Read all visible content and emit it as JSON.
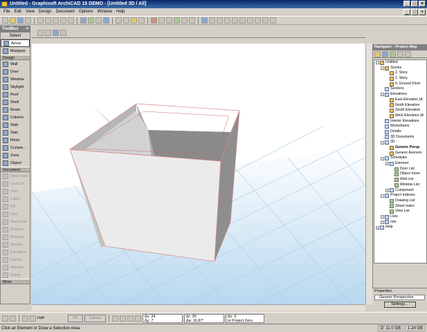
{
  "window": {
    "title": "Untitled - Graphisoft ArchiCAD 15 DEMO - [Untitled 3D / All]"
  },
  "menu": [
    "File",
    "Edit",
    "View",
    "Design",
    "Document",
    "Options",
    "Window",
    "Help"
  ],
  "toolbox": {
    "title": "ToolBox",
    "select_label": "Select",
    "arrow": "Arrow",
    "marquee": "Marquee",
    "design_label": "Design",
    "design_tools": [
      "Wall",
      "Door",
      "Window",
      "Skylight",
      "Roof",
      "Shell",
      "Beam",
      "Column",
      "Slab",
      "Stair",
      "Mesh",
      "Curtain...",
      "Zone",
      "Object"
    ],
    "document_label": "Document",
    "document_tools": [
      "Dimension",
      "Level Di...",
      "Text",
      "Label",
      "Fill",
      "Line",
      "Arc/Circle",
      "Polyline",
      "Drawing",
      "Section",
      "Elevation",
      "Interior...",
      "Worksh...",
      "Detail"
    ],
    "more": "More"
  },
  "navigator": {
    "title": "Navigator - Project Map",
    "tree": [
      {
        "label": "Untitled",
        "level": 0,
        "expand": "-",
        "icon": "y"
      },
      {
        "label": "Stories",
        "level": 1,
        "expand": "-",
        "icon": "y"
      },
      {
        "label": "2. Story",
        "level": 2,
        "expand": "",
        "icon": "y"
      },
      {
        "label": "1. Story",
        "level": 2,
        "expand": "",
        "icon": "y"
      },
      {
        "label": "0. Ground Floor",
        "level": 2,
        "expand": "",
        "icon": "y"
      },
      {
        "label": "Sections",
        "level": 1,
        "expand": "",
        "icon": "s"
      },
      {
        "label": "Elevations",
        "level": 1,
        "expand": "-",
        "icon": "s"
      },
      {
        "label": "East Elevation (A",
        "level": 2,
        "expand": "",
        "icon": "y"
      },
      {
        "label": "North Elevation",
        "level": 2,
        "expand": "",
        "icon": "y"
      },
      {
        "label": "South Elevation",
        "level": 2,
        "expand": "",
        "icon": "y"
      },
      {
        "label": "West Elevation (A",
        "level": 2,
        "expand": "",
        "icon": "y"
      },
      {
        "label": "Interior Elevations",
        "level": 1,
        "expand": "",
        "icon": "s"
      },
      {
        "label": "Worksheets",
        "level": 1,
        "expand": "",
        "icon": "s"
      },
      {
        "label": "Details",
        "level": 1,
        "expand": "",
        "icon": "s"
      },
      {
        "label": "3D Documents",
        "level": 1,
        "expand": "",
        "icon": "s"
      },
      {
        "label": "3D",
        "level": 1,
        "expand": "-",
        "icon": "s"
      },
      {
        "label": "Generic Persp",
        "level": 2,
        "expand": "",
        "icon": "y",
        "selected": true
      },
      {
        "label": "Generic Axonom",
        "level": 2,
        "expand": "",
        "icon": "y"
      },
      {
        "label": "Schedules",
        "level": 1,
        "expand": "-",
        "icon": "s"
      },
      {
        "label": "Element",
        "level": 2,
        "expand": "-",
        "icon": "s"
      },
      {
        "label": "Door List",
        "level": 3,
        "expand": "",
        "icon": "g"
      },
      {
        "label": "Object Inven",
        "level": 3,
        "expand": "",
        "icon": "g"
      },
      {
        "label": "Wall List",
        "level": 3,
        "expand": "",
        "icon": "g"
      },
      {
        "label": "Window List",
        "level": 3,
        "expand": "",
        "icon": "g"
      },
      {
        "label": "Component",
        "level": 2,
        "expand": "+",
        "icon": "s"
      },
      {
        "label": "Project Indexes",
        "level": 1,
        "expand": "-",
        "icon": "s"
      },
      {
        "label": "Drawing List",
        "level": 2,
        "expand": "",
        "icon": "g"
      },
      {
        "label": "Sheet Index",
        "level": 2,
        "expand": "",
        "icon": "g"
      },
      {
        "label": "View List",
        "level": 2,
        "expand": "",
        "icon": "g"
      },
      {
        "label": "Lists",
        "level": 1,
        "expand": "+",
        "icon": "s"
      },
      {
        "label": "Info",
        "level": 1,
        "expand": "+",
        "icon": "s"
      },
      {
        "label": "Help",
        "level": 0,
        "expand": "+",
        "icon": "s"
      }
    ],
    "properties_label": "Properties",
    "properties_value": "Generic Perspective",
    "settings_button": "Settings..."
  },
  "bottom": {
    "zoom_label": "Half",
    "ok": "OK",
    "cancel": "Cancel",
    "dx_label": "Δx:",
    "dx": "24",
    "dy_label": "Δy:",
    "dy": "7",
    "r_label": "Δr:",
    "r": "25",
    "a_label": "Δa:",
    "a": "16,97°",
    "z_label": "Δz:",
    "z": "0",
    "z_ref": "to Project Zero"
  },
  "status": {
    "message": "Click an Element or Draw a Selection Area.",
    "disk": "D: 11.0 GB",
    "ram": "1.24 GB"
  }
}
